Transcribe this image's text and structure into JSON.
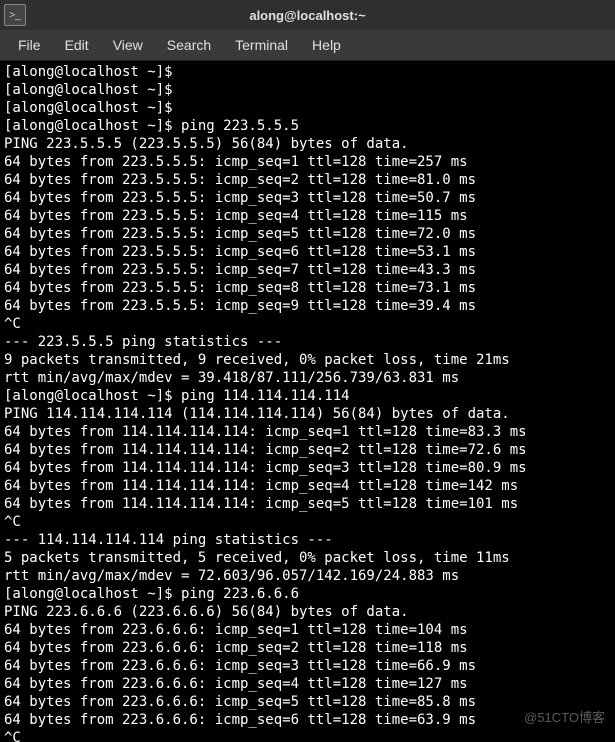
{
  "titlebar": {
    "title": "along@localhost:~"
  },
  "menu": {
    "file": "File",
    "edit": "Edit",
    "view": "View",
    "search": "Search",
    "terminal": "Terminal",
    "help": "Help"
  },
  "lines": {
    "l0": "[along@localhost ~]$ ",
    "l1": "[along@localhost ~]$ ",
    "l2": "[along@localhost ~]$ ",
    "l3": "[along@localhost ~]$ ping 223.5.5.5",
    "l4": "PING 223.5.5.5 (223.5.5.5) 56(84) bytes of data.",
    "l5": "64 bytes from 223.5.5.5: icmp_seq=1 ttl=128 time=257 ms",
    "l6": "64 bytes from 223.5.5.5: icmp_seq=2 ttl=128 time=81.0 ms",
    "l7": "64 bytes from 223.5.5.5: icmp_seq=3 ttl=128 time=50.7 ms",
    "l8": "64 bytes from 223.5.5.5: icmp_seq=4 ttl=128 time=115 ms",
    "l9": "64 bytes from 223.5.5.5: icmp_seq=5 ttl=128 time=72.0 ms",
    "l10": "64 bytes from 223.5.5.5: icmp_seq=6 ttl=128 time=53.1 ms",
    "l11": "64 bytes from 223.5.5.5: icmp_seq=7 ttl=128 time=43.3 ms",
    "l12": "64 bytes from 223.5.5.5: icmp_seq=8 ttl=128 time=73.1 ms",
    "l13": "64 bytes from 223.5.5.5: icmp_seq=9 ttl=128 time=39.4 ms",
    "l14": "^C",
    "l15": "--- 223.5.5.5 ping statistics ---",
    "l16": "9 packets transmitted, 9 received, 0% packet loss, time 21ms",
    "l17": "rtt min/avg/max/mdev = 39.418/87.111/256.739/63.831 ms",
    "l18": "[along@localhost ~]$ ping 114.114.114.114",
    "l19": "PING 114.114.114.114 (114.114.114.114) 56(84) bytes of data.",
    "l20": "64 bytes from 114.114.114.114: icmp_seq=1 ttl=128 time=83.3 ms",
    "l21": "64 bytes from 114.114.114.114: icmp_seq=2 ttl=128 time=72.6 ms",
    "l22": "64 bytes from 114.114.114.114: icmp_seq=3 ttl=128 time=80.9 ms",
    "l23": "64 bytes from 114.114.114.114: icmp_seq=4 ttl=128 time=142 ms",
    "l24": "64 bytes from 114.114.114.114: icmp_seq=5 ttl=128 time=101 ms",
    "l25": "^C",
    "l26": "--- 114.114.114.114 ping statistics ---",
    "l27": "5 packets transmitted, 5 received, 0% packet loss, time 11ms",
    "l28": "rtt min/avg/max/mdev = 72.603/96.057/142.169/24.883 ms",
    "l29": "[along@localhost ~]$ ping 223.6.6.6",
    "l30": "PING 223.6.6.6 (223.6.6.6) 56(84) bytes of data.",
    "l31": "64 bytes from 223.6.6.6: icmp_seq=1 ttl=128 time=104 ms",
    "l32": "64 bytes from 223.6.6.6: icmp_seq=2 ttl=128 time=118 ms",
    "l33": "64 bytes from 223.6.6.6: icmp_seq=3 ttl=128 time=66.9 ms",
    "l34": "64 bytes from 223.6.6.6: icmp_seq=4 ttl=128 time=127 ms",
    "l35": "64 bytes from 223.6.6.6: icmp_seq=5 ttl=128 time=85.8 ms",
    "l36": "64 bytes from 223.6.6.6: icmp_seq=6 ttl=128 time=63.9 ms",
    "l37": "^C"
  },
  "watermark": "@51CTO博客"
}
